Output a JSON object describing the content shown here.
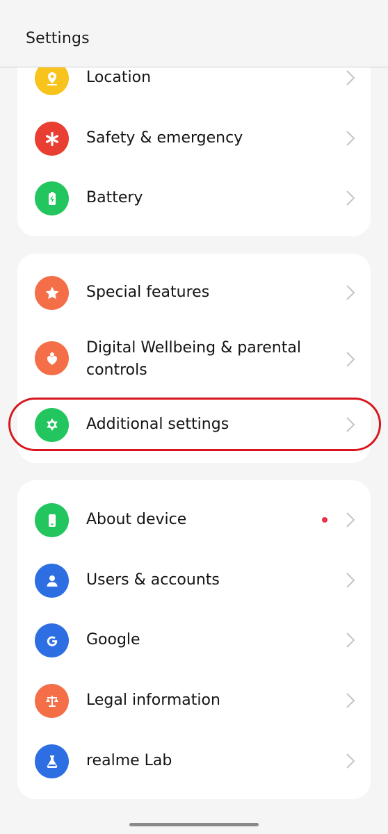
{
  "header": {
    "title": "Settings"
  },
  "groups": [
    {
      "items": [
        {
          "label": "Location",
          "icon": "location-pin-icon",
          "color": "#f8c31c"
        },
        {
          "label": "Safety & emergency",
          "icon": "asterisk-icon",
          "color": "#e93f33"
        },
        {
          "label": "Battery",
          "icon": "battery-icon",
          "color": "#22c55e"
        }
      ]
    },
    {
      "items": [
        {
          "label": "Special features",
          "icon": "star-icon",
          "color": "#f46f47"
        },
        {
          "label": "Digital Wellbeing & parental\ncontrols",
          "icon": "heart-person-icon",
          "color": "#f46f47"
        },
        {
          "label": "Additional settings",
          "icon": "gear-icon",
          "color": "#22c55e"
        }
      ]
    },
    {
      "items": [
        {
          "label": "About device",
          "icon": "phone-icon",
          "color": "#22c55e",
          "badge_color": "#e8334a"
        },
        {
          "label": "Users & accounts",
          "icon": "user-icon",
          "color": "#2d6fe3"
        },
        {
          "label": "Google",
          "icon": "google-icon",
          "color": "#2d6fe3"
        },
        {
          "label": "Legal information",
          "icon": "scales-icon",
          "color": "#f46f47"
        },
        {
          "label": "realme Lab",
          "icon": "flask-icon",
          "color": "#2d6fe3"
        }
      ]
    }
  ],
  "highlight_color": "#d8141c"
}
